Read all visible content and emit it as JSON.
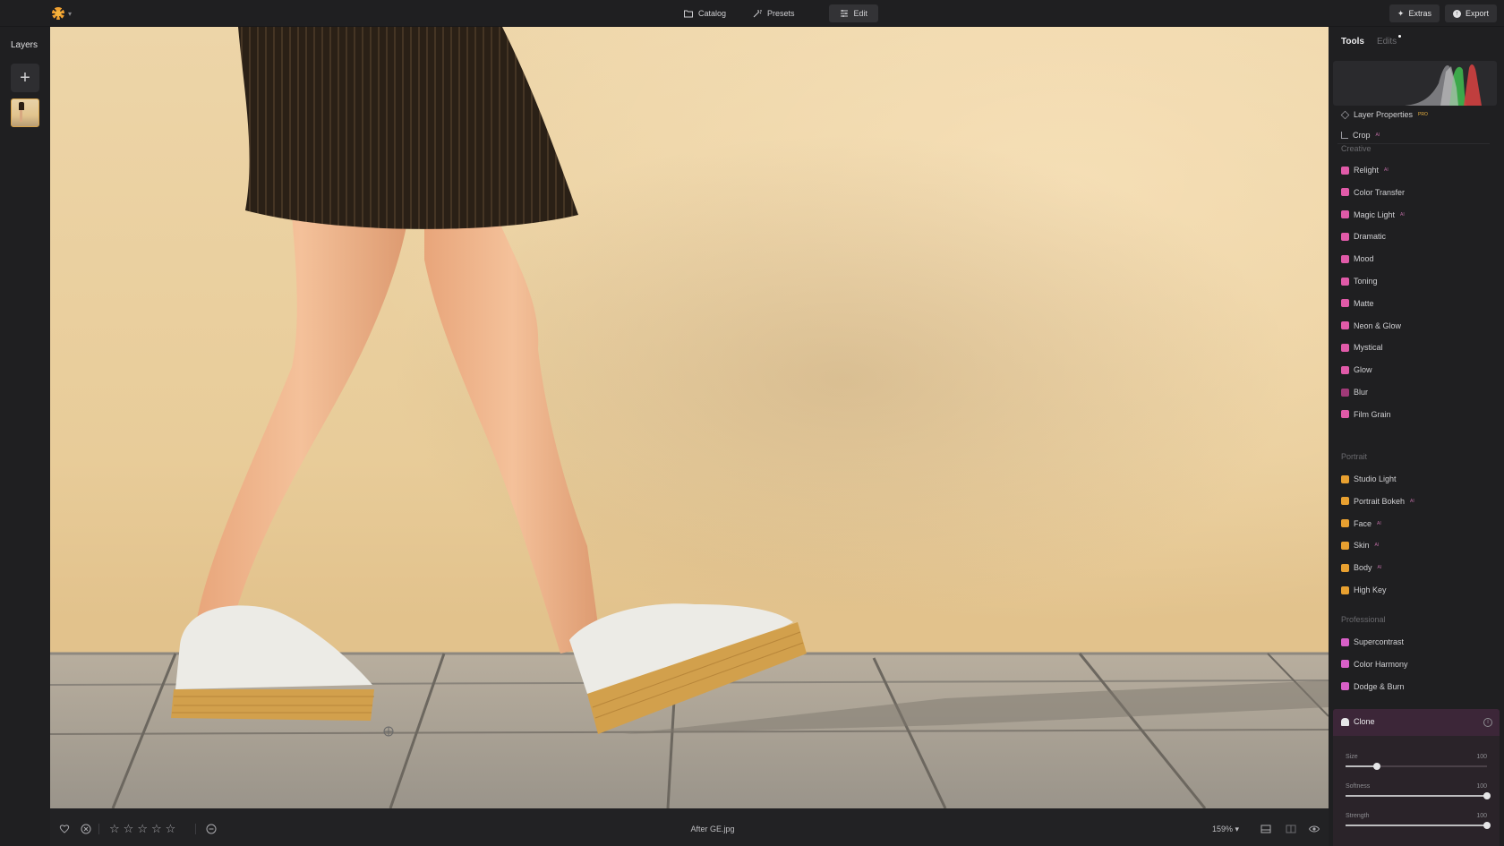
{
  "top_bar": {
    "app_icon": "sun-icon",
    "mode_tabs": [
      {
        "label": "Catalog",
        "icon": "folder-icon"
      },
      {
        "label": "Presets",
        "icon": "magic-icon"
      },
      {
        "label": "Edit",
        "icon": "sliders-icon",
        "active": true
      }
    ],
    "extras_label": "Extras",
    "export_label": "Export"
  },
  "layers": {
    "title": "Layers",
    "add_icon": "plus-icon"
  },
  "bottom_bar": {
    "filename": "After GE.jpg",
    "zoom": "159%",
    "stars": [
      "☆",
      "☆",
      "☆",
      "☆",
      "☆"
    ]
  },
  "tools_panel": {
    "tabs": {
      "tools": "Tools",
      "edits": "Edits"
    },
    "essentials": [
      {
        "label": "Layer Properties",
        "badge": "PRO",
        "color": "#9a9aa0"
      },
      {
        "label": "Crop",
        "badge": "AI",
        "color": "#9a9aa0"
      }
    ],
    "creative_header": "Creative",
    "creative": [
      {
        "label": "Relight",
        "badge": "AI",
        "color": "#e05aa8"
      },
      {
        "label": "Color Transfer",
        "badge": "",
        "color": "#e05aa8"
      },
      {
        "label": "Magic Light",
        "badge": "AI",
        "color": "#e05aa8"
      },
      {
        "label": "Dramatic",
        "badge": "",
        "color": "#e05aa8"
      },
      {
        "label": "Mood",
        "badge": "",
        "color": "#e05aa8"
      },
      {
        "label": "Toning",
        "badge": "",
        "color": "#e05aa8"
      },
      {
        "label": "Matte",
        "badge": "",
        "color": "#e05aa8"
      },
      {
        "label": "Neon & Glow",
        "badge": "",
        "color": "#e05aa8"
      },
      {
        "label": "Mystical",
        "badge": "",
        "color": "#e05aa8"
      },
      {
        "label": "Glow",
        "badge": "",
        "color": "#e05aa8"
      },
      {
        "label": "Blur",
        "badge": "",
        "color": "#a03a78"
      },
      {
        "label": "Film Grain",
        "badge": "",
        "color": "#e05aa8"
      }
    ],
    "portrait_header": "Portrait",
    "portrait": [
      {
        "label": "Studio Light",
        "badge": "",
        "color": "#e8a030"
      },
      {
        "label": "Portrait Bokeh",
        "badge": "AI",
        "color": "#e8a030"
      },
      {
        "label": "Face",
        "badge": "AI",
        "color": "#e8a030"
      },
      {
        "label": "Skin",
        "badge": "AI",
        "color": "#e8a030"
      },
      {
        "label": "Body",
        "badge": "AI",
        "color": "#e8a030"
      },
      {
        "label": "High Key",
        "badge": "",
        "color": "#e8a030"
      }
    ],
    "professional_header": "Professional",
    "professional": [
      {
        "label": "Supercontrast",
        "badge": "",
        "color": "#d860c8"
      },
      {
        "label": "Color Harmony",
        "badge": "",
        "color": "#d860c8"
      },
      {
        "label": "Dodge & Burn",
        "badge": "",
        "color": "#d860c8"
      }
    ],
    "clone": {
      "title": "Clone",
      "sliders": [
        {
          "label": "Size",
          "value": "100",
          "level": 0.22
        },
        {
          "label": "Softness",
          "value": "100",
          "level": 1.0
        },
        {
          "label": "Strength",
          "value": "100",
          "level": 1.0
        }
      ]
    }
  }
}
